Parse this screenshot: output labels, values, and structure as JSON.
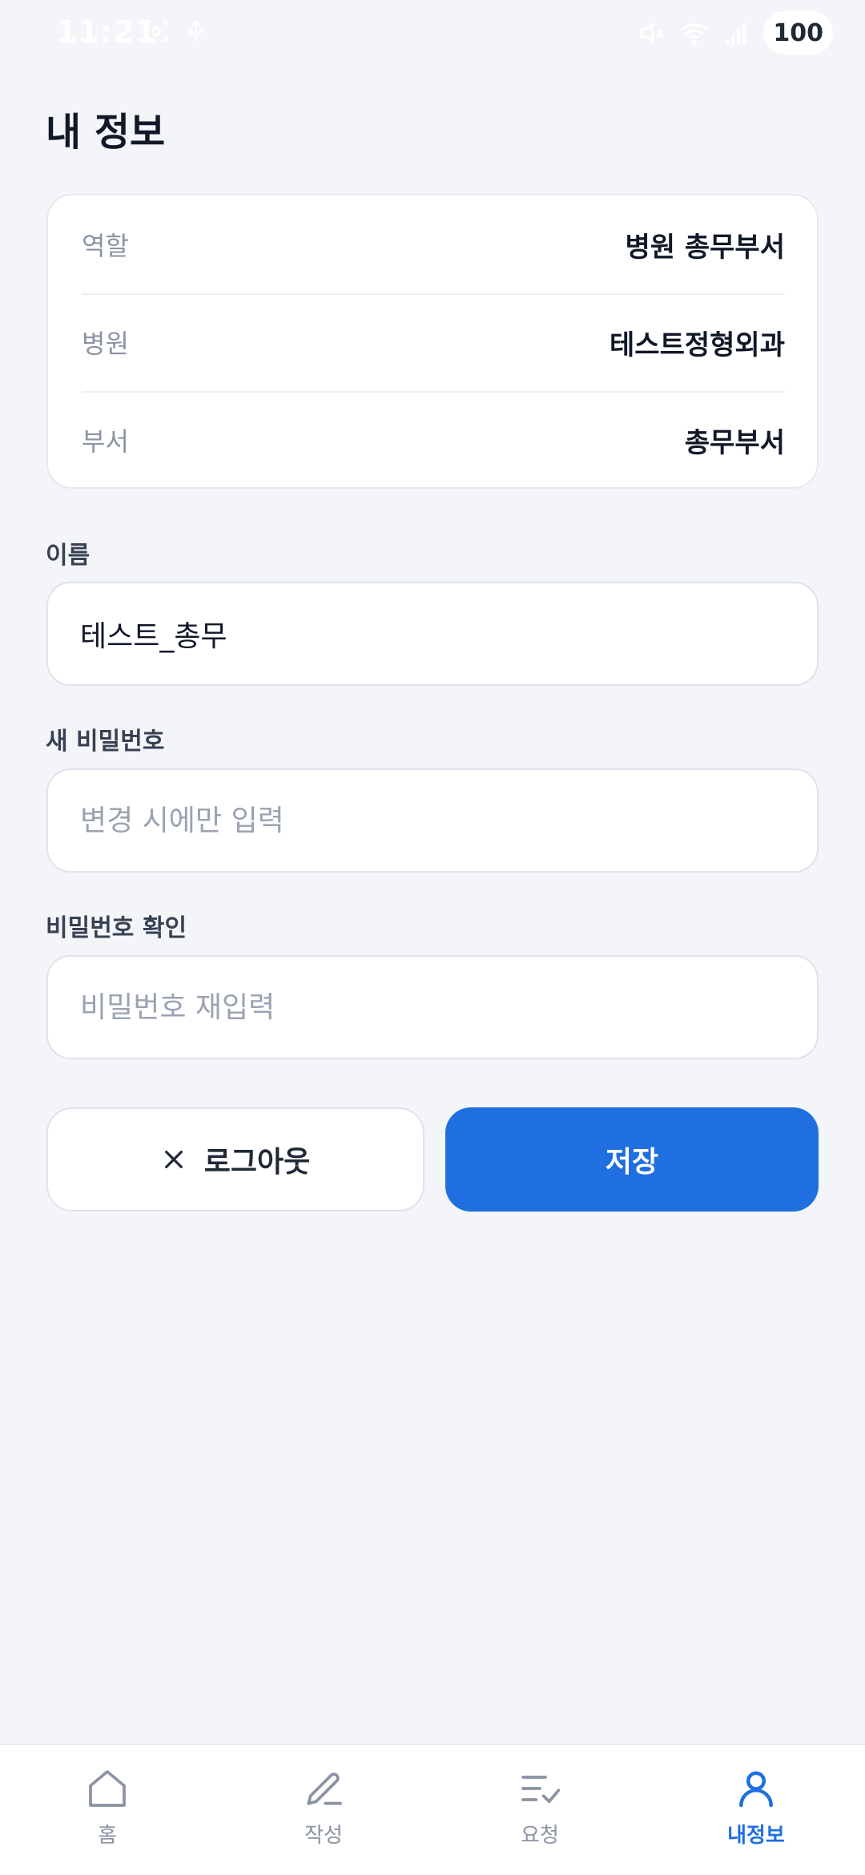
{
  "status_bar": {
    "time": "11:21",
    "battery": "100"
  },
  "page": {
    "title": "내 정보"
  },
  "info": {
    "rows": [
      {
        "label": "역할",
        "value": "병원 총무부서"
      },
      {
        "label": "병원",
        "value": "테스트정형외과"
      },
      {
        "label": "부서",
        "value": "총무부서"
      }
    ]
  },
  "form": {
    "name": {
      "label": "이름",
      "value": "테스트_총무",
      "placeholder": ""
    },
    "new_password": {
      "label": "새 비밀번호",
      "value": "",
      "placeholder": "변경 시에만 입력"
    },
    "confirm_password": {
      "label": "비밀번호 확인",
      "value": "",
      "placeholder": "비밀번호 재입력"
    }
  },
  "buttons": {
    "logout_label": "로그아웃",
    "save_label": "저장"
  },
  "nav": {
    "active": "me",
    "items": [
      {
        "key": "home",
        "label": "홈",
        "icon": "home-icon"
      },
      {
        "key": "write",
        "label": "작성",
        "icon": "pencil-icon"
      },
      {
        "key": "request",
        "label": "요청",
        "icon": "checklist-icon"
      },
      {
        "key": "me",
        "label": "내정보",
        "icon": "user-icon"
      }
    ]
  },
  "colors": {
    "accent": "#1f6fe0",
    "background": "#f3f5f9",
    "muted_text": "#8a93a3"
  }
}
